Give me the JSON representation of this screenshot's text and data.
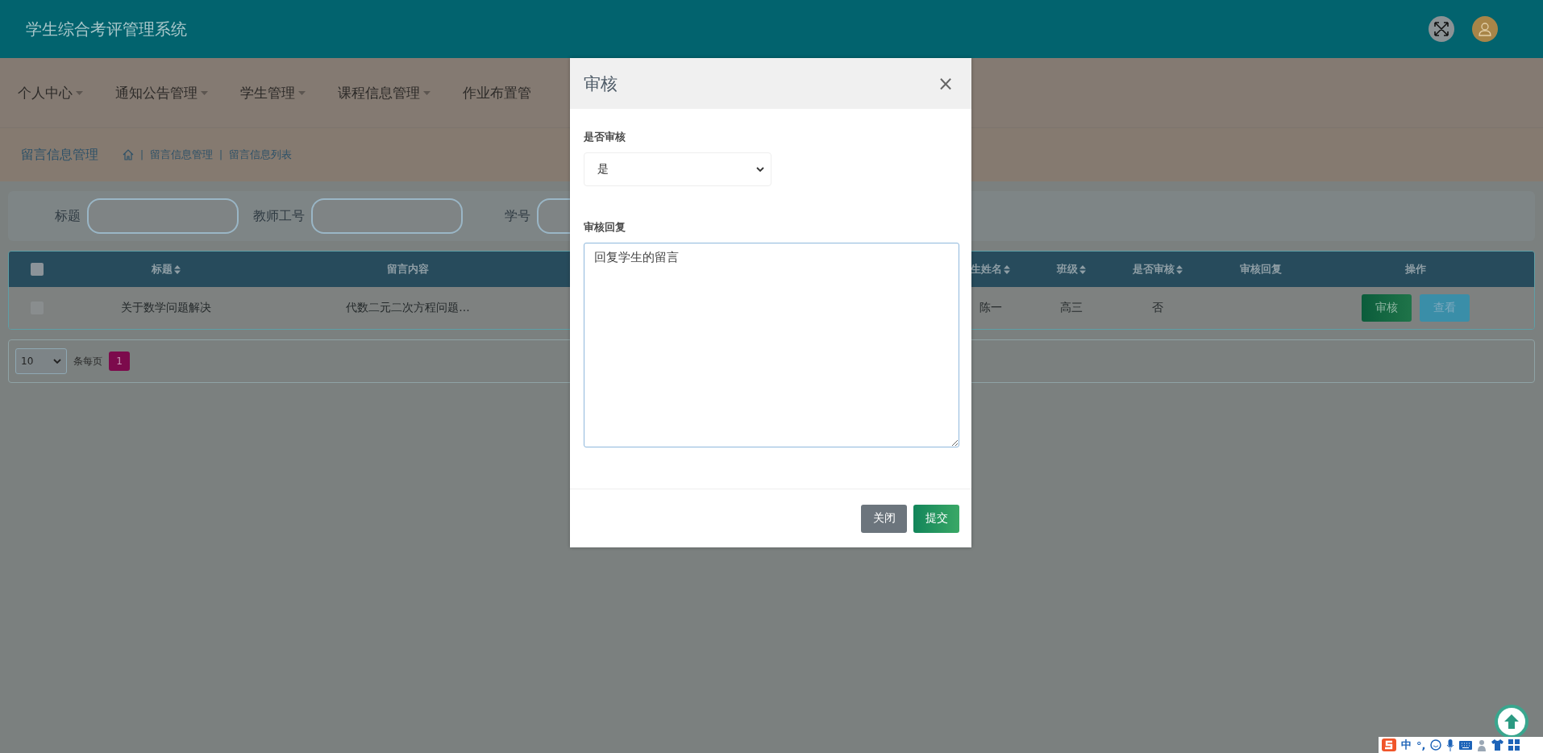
{
  "header": {
    "title": "学生综合考评管理系统"
  },
  "nav": {
    "items": [
      {
        "label": "个人中心"
      },
      {
        "label": "通知公告管理"
      },
      {
        "label": "学生管理"
      },
      {
        "label": "课程信息管理"
      },
      {
        "label": "作业布置管"
      }
    ]
  },
  "breadcrumb": {
    "title": "留言信息管理",
    "separator": "|",
    "path": [
      "留言信息管理",
      "留言信息列表"
    ]
  },
  "search": {
    "fields": [
      {
        "label": "标题"
      },
      {
        "label": "教师工号"
      },
      {
        "label": "学号"
      }
    ]
  },
  "table": {
    "all_selected": false,
    "columns": [
      {
        "label": "标题",
        "sortable": true
      },
      {
        "label": "留言内容",
        "sortable": false
      },
      {
        "label": "生姓名",
        "sortable": true
      },
      {
        "label": "班级",
        "sortable": true
      },
      {
        "label": "是否审核",
        "sortable": true
      },
      {
        "label": "审核回复",
        "sortable": false
      },
      {
        "label": "操作",
        "sortable": false
      }
    ],
    "rows": [
      {
        "selected": false,
        "cells": [
          "关于数学问题解决",
          "代数二元二次方程问题...",
          "陈一",
          "高三",
          "否",
          ""
        ],
        "actions": [
          {
            "label": "审核",
            "kind": "review"
          },
          {
            "label": "查看",
            "kind": "view"
          }
        ]
      }
    ]
  },
  "pagination": {
    "page_size": "10",
    "per_page_label": "条每页",
    "pages": [
      {
        "label": "1",
        "selected": true
      }
    ]
  },
  "modal": {
    "title": "审核",
    "close": "×",
    "fields": [
      {
        "kind": "select",
        "label": "是否审核",
        "value": "是"
      },
      {
        "kind": "textarea",
        "label": "审核回复",
        "value": "回复学生的留言"
      }
    ],
    "buttons": [
      {
        "label": "关闭",
        "kind": "secondary"
      },
      {
        "label": "提交",
        "kind": "primary"
      }
    ]
  },
  "ime_bar": {
    "items": [
      "中",
      "°,"
    ]
  }
}
